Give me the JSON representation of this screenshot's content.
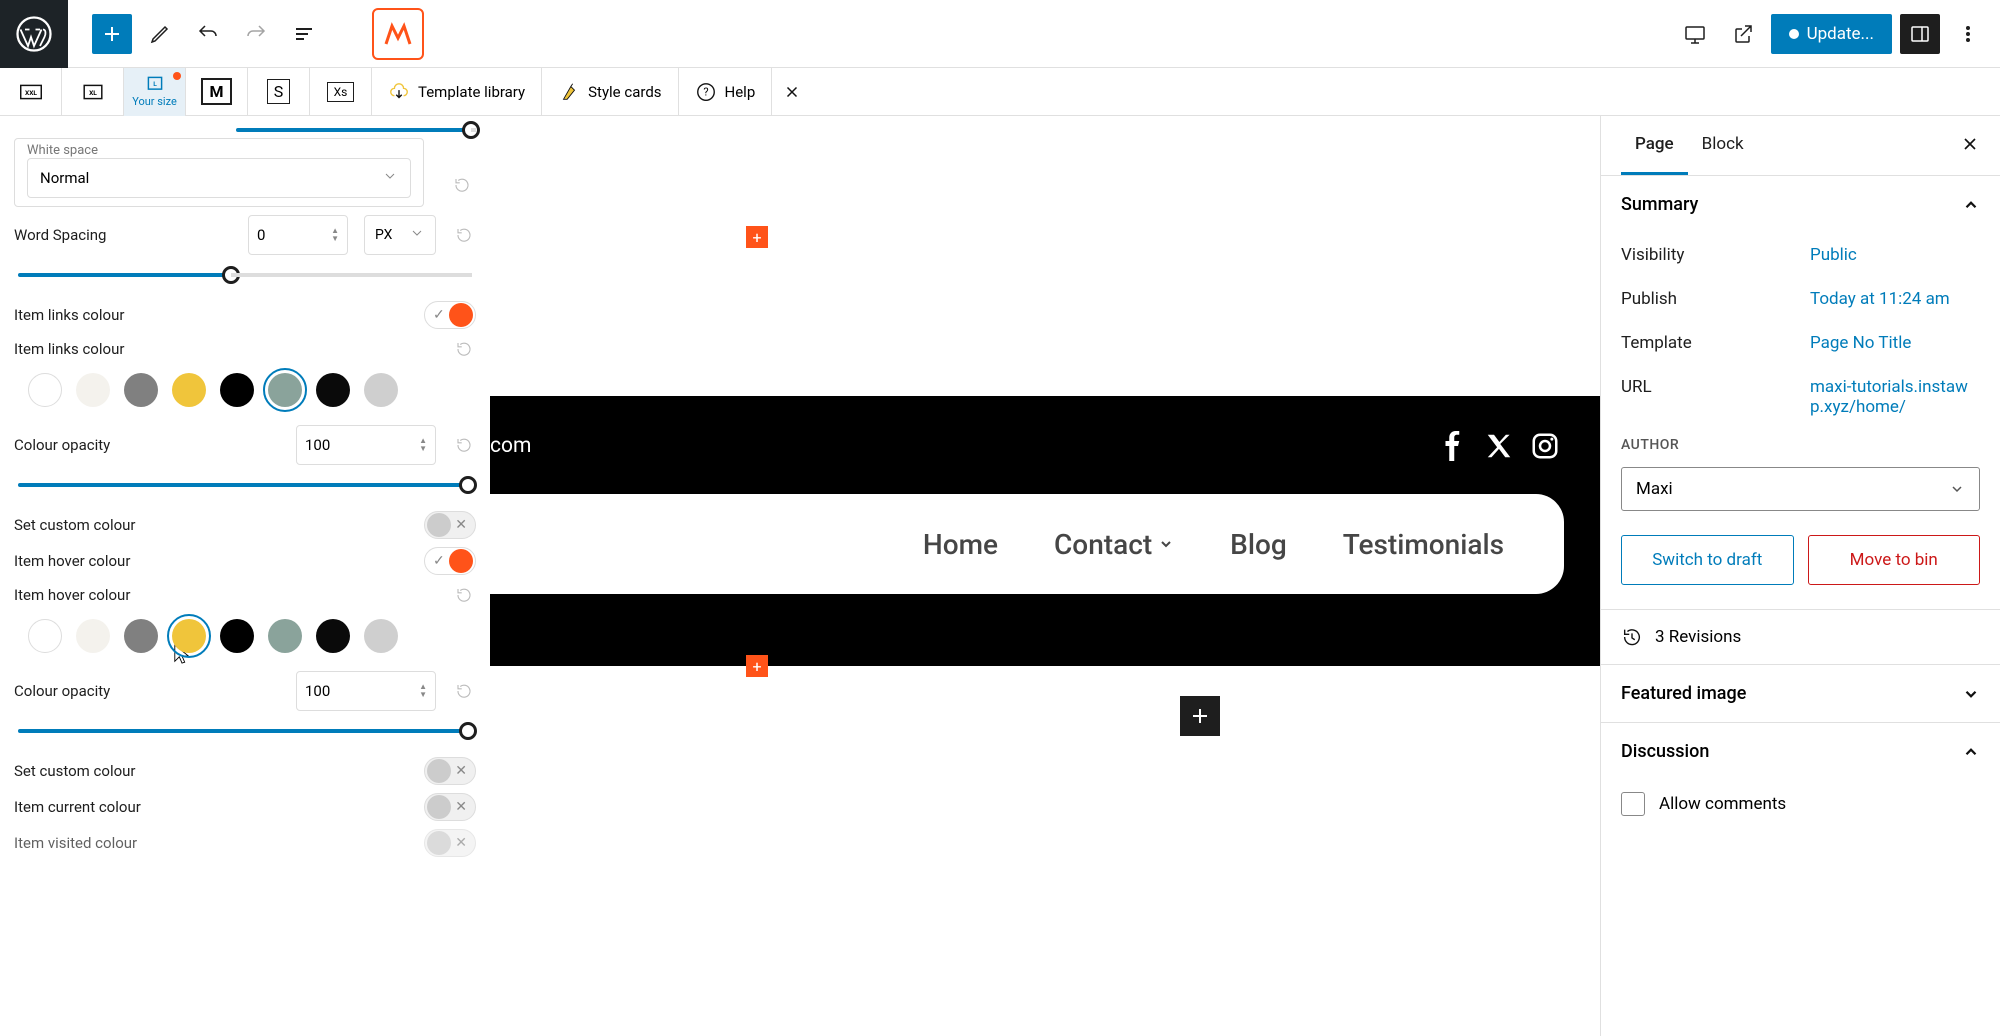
{
  "toolbar": {
    "update_label": "Update...",
    "template_library": "Template library",
    "style_cards": "Style cards",
    "help": "Help"
  },
  "size_tabs": {
    "xxl": "XXL",
    "xl": "XL",
    "your_size": "Your size",
    "m": "M",
    "s": "S",
    "xs": "Xs"
  },
  "left": {
    "white_space_label": "White space",
    "white_space_value": "Normal",
    "word_spacing_label": "Word Spacing",
    "word_spacing_value": "0",
    "word_spacing_unit": "PX",
    "item_links_colour": "Item links colour",
    "item_links_colour2": "Item links colour",
    "colour_opacity": "Colour opacity",
    "opacity_value": "100",
    "set_custom_colour": "Set custom colour",
    "item_hover_colour": "Item hover colour",
    "item_hover_colour2": "Item hover colour",
    "item_current_colour": "Item current colour",
    "item_visited_colour": "Item visited colour",
    "swatches_a": [
      {
        "c": "#ffffff",
        "empty": true
      },
      {
        "c": "#f4f2ed"
      },
      {
        "c": "#808080"
      },
      {
        "c": "#f0c53b"
      },
      {
        "c": "#000000"
      },
      {
        "c": "#8aa39b",
        "selected": true
      },
      {
        "c": "#0a0a0a"
      },
      {
        "c": "#cfcfcf"
      }
    ],
    "swatches_b": [
      {
        "c": "#ffffff",
        "empty": true
      },
      {
        "c": "#f4f2ed"
      },
      {
        "c": "#808080"
      },
      {
        "c": "#f0c53b",
        "selected": true
      },
      {
        "c": "#000000"
      },
      {
        "c": "#8aa39b"
      },
      {
        "c": "#0a0a0a"
      },
      {
        "c": "#cfcfcf"
      }
    ]
  },
  "canvas": {
    "email_frag": "com",
    "nav": {
      "home": "Home",
      "contact": "Contact",
      "blog": "Blog",
      "testimonials": "Testimonials"
    },
    "plus": "+"
  },
  "right": {
    "tab_page": "Page",
    "tab_block": "Block",
    "summary": "Summary",
    "visibility_label": "Visibility",
    "visibility_value": "Public",
    "publish_label": "Publish",
    "publish_value": "Today at 11:24 am",
    "template_label": "Template",
    "template_value": "Page No Title",
    "url_label": "URL",
    "url_value": "maxi-tutorials.instawp.xyz/home/",
    "author_label": "AUTHOR",
    "author_value": "Maxi",
    "switch_draft": "Switch to draft",
    "move_bin": "Move to bin",
    "revisions": "3 Revisions",
    "featured_image": "Featured image",
    "discussion": "Discussion",
    "allow_comments": "Allow comments"
  }
}
